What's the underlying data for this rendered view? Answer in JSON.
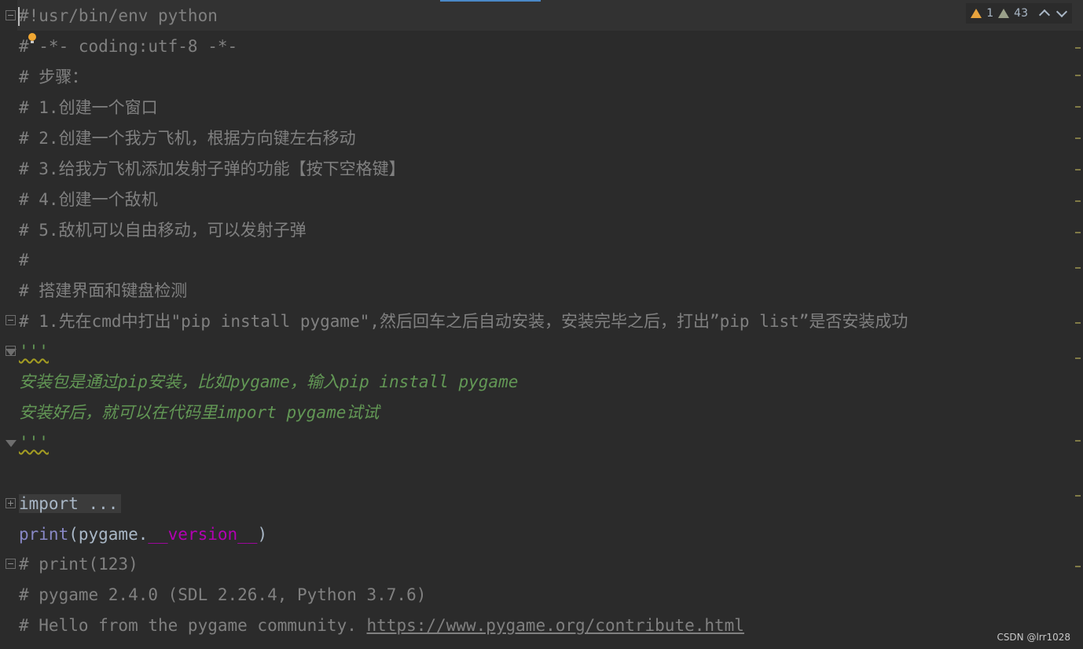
{
  "editor": {
    "lines": {
      "l1": "#!usr/bin/env python",
      "l2": "# -*- coding:utf-8 -*-",
      "l3": "# 步骤：",
      "l4": "# 1.创建一个窗口",
      "l5": "# 2.创建一个我方飞机，根据方向键左右移动",
      "l6": "# 3.给我方飞机添加发射子弹的功能【按下空格键】",
      "l7": "# 4.创建一个敌机",
      "l8": "# 5.敌机可以自由移动，可以发射子弹",
      "l9": "#",
      "l10": "# 搭建界面和键盘检测",
      "l11": "# 1.先在cmd中打出\"pip install pygame\",然后回车之后自动安装，安装完毕之后，打出”pip list”是否安装成功",
      "l12": "'''",
      "l13": "安装包是通过pip安装，比如pygame，输入pip install pygame",
      "l14": "安装好后，就可以在代码里import pygame试试",
      "l15": "'''",
      "l17": "import ...",
      "l18_print": "print",
      "l18_open": "(pygame.",
      "l18_dunder": "__version__",
      "l18_close": ")",
      "l19": "# print(123)",
      "l20": "# pygame 2.4.0 (SDL 2.26.4, Python 3.7.6)",
      "l21_prefix": "# Hello from the pygame community. ",
      "l21_link": "https://www.pygame.org/contribute.html"
    }
  },
  "inspection": {
    "errors_count": "1",
    "warnings_count": "43"
  },
  "watermark": "CSDN @lrr1028",
  "colors": {
    "background": "#2b2b2b",
    "comment": "#808080",
    "docstring": "#629755",
    "builtin": "#8888c6",
    "dunder": "#b200b2",
    "warning": "#e8a33d"
  }
}
